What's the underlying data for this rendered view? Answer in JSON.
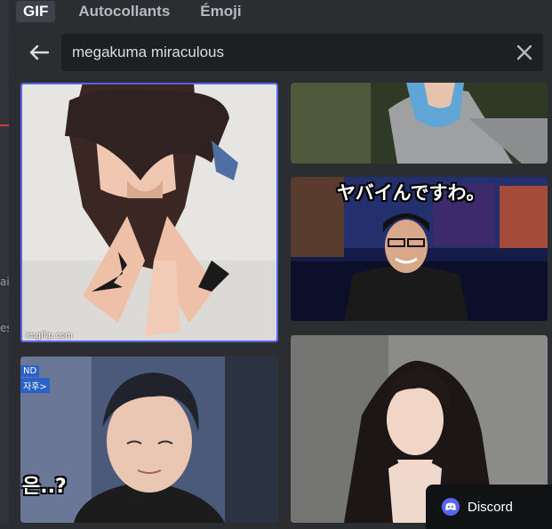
{
  "tabs": [
    {
      "label": "GIF",
      "active": true
    },
    {
      "label": "Autocollants",
      "active": false
    },
    {
      "label": "Émoji",
      "active": false
    }
  ],
  "search": {
    "value": "megakuma miraculous",
    "back_icon": "arrow-left-icon",
    "clear_icon": "close-icon"
  },
  "left_fragments": [
    "ai",
    "es"
  ],
  "gifs": [
    {
      "watermark": "imgflip.com"
    },
    {},
    {
      "caption": "ヤバイんですわ。"
    },
    {
      "caption": "은..?",
      "logo_top": "ND",
      "logo_bottom": "자후>"
    },
    {}
  ],
  "toast": {
    "label": "Discord",
    "icon": "discord-logo-icon"
  },
  "colors": {
    "background": "#2b2d31",
    "search_bg": "#1e1f22",
    "active_tab_bg": "#404249",
    "selection_outline": "#5865f2",
    "brand": "#5865f2"
  }
}
